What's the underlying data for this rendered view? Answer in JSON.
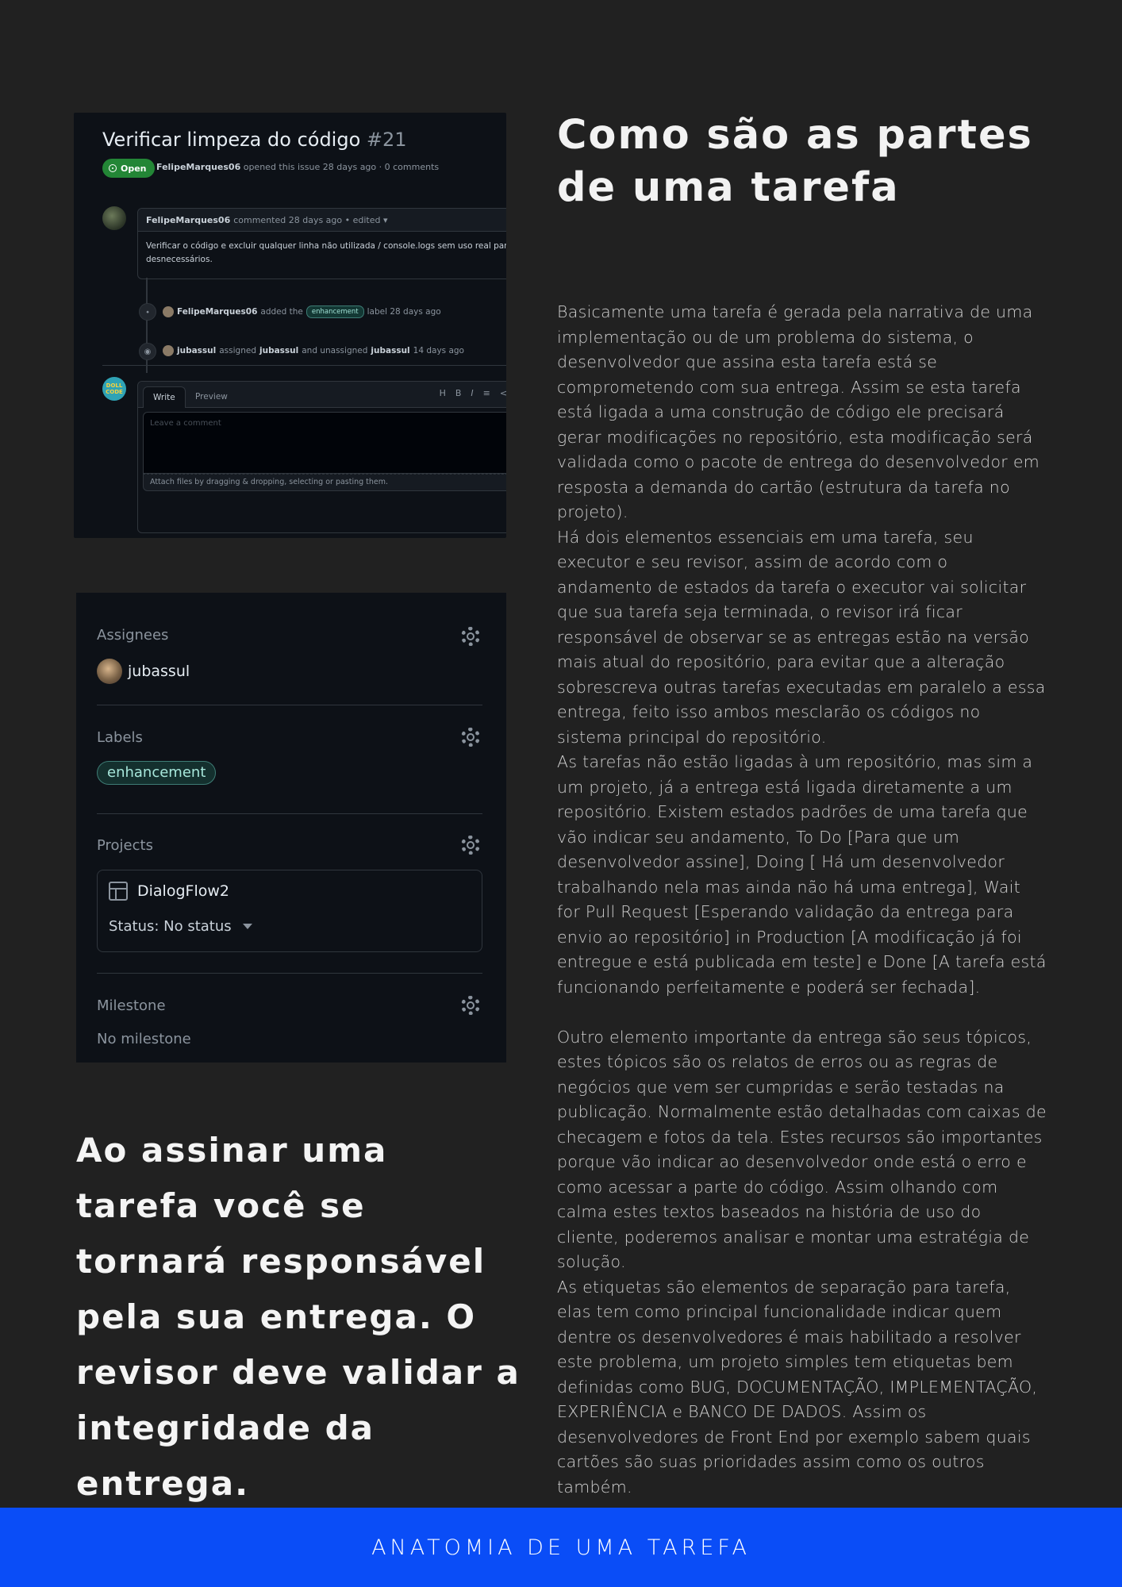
{
  "heading": "Como são as partes de uma tarefa",
  "paragraphs": [
    "Basicamente uma tarefa é gerada pela narrativa de uma implementação ou de um problema do sistema, o desenvolvedor que assina esta tarefa está se comprometendo com sua entrega. Assim se esta tarefa está ligada a uma construção de código ele precisará gerar modificações no repositório, esta modificação será validada como o pacote de entrega do desenvolvedor em resposta a demanda do cartão (estrutura da tarefa no projeto).",
    "Há dois elementos essenciais em uma tarefa, seu executor e seu revisor, assim de acordo com o andamento de estados da tarefa o executor vai solicitar que sua tarefa seja terminada, o revisor irá ficar responsável de observar se as entregas estão na versão mais atual do repositório, para evitar que a alteração sobrescreva outras tarefas executadas em paralelo a essa entrega, feito isso ambos mesclarão os códigos no sistema principal do repositório.",
    "As tarefas não estão ligadas à um repositório, mas sim a um projeto, já a entrega está ligada diretamente a um repositório. Existem estados padrões de uma tarefa que vão indicar seu andamento, To Do [Para que um desenvolvedor assine], Doing [ Há um desenvolvedor trabalhando nela mas ainda não há uma entrega], Wait for Pull Request [Esperando validação da entrega para envio ao repositório] in Production [A modificação já foi entregue e está publicada em teste] e Done [A tarefa está funcionando perfeitamente e poderá ser fechada].",
    "Outro elemento importante da entrega são seus tópicos, estes tópicos são os relatos de erros ou as regras de negócios que vem ser cumpridas e serão testadas na publicação. Normalmente estão detalhadas com caixas de checagem e fotos da tela. Estes recursos são importantes porque vão indicar ao desenvolvedor onde está o erro e como acessar a parte do código. Assim olhando com calma estes textos baseados na história de uso do cliente, poderemos analisar e montar uma estratégia de solução.",
    "As etiquetas são elementos de separação para tarefa, elas tem como principal funcionalidade indicar quem dentre os desenvolvedores é mais habilitado a resolver este problema, um projeto simples tem etiquetas bem definidas como BUG, DOCUMENTAÇÃO, IMPLEMENTAÇÃO, EXPERIÊNCIA e BANCO DE DADOS. Assim os desenvolvedores de Front End por exemplo sabem quais cartões são suas prioridades assim como os outros também."
  ],
  "quote": "Ao assinar uma tarefa você se tornará responsável pela sua entrega. O revisor deve validar a integridade da entrega.",
  "banner": "ANATOMIA DE UMA TAREFA",
  "issue": {
    "title": "Verificar limpeza do código",
    "number": "#21",
    "state": "Open",
    "meta_author": "FelipeMarques06",
    "meta_text": "opened this issue 28 days ago · 0 comments",
    "comment_author": "FelipeMarques06",
    "comment_meta": "commented 28 days ago • edited ▾",
    "comment_line1": "Verificar o código e excluir qualquer linha não utilizada / console.logs sem uso real para a aplicação",
    "comment_line2": "desnecessários.",
    "event1": {
      "author": "FelipeMarques06",
      "pre": "added the",
      "label": "enhancement",
      "post": "label 28 days ago"
    },
    "event2": {
      "author": "jubassul",
      "pre": "assigned",
      "target": "jubassul",
      "mid": "and unassigned",
      "target2": "jubassul",
      "post": "14 days ago"
    },
    "avatar_text": "DOLL CODE",
    "tab_write": "Write",
    "tab_preview": "Preview",
    "toolbar": [
      "H",
      "B",
      "I",
      "≡",
      "<>",
      "🔗"
    ],
    "comment_placeholder": "Leave a comment",
    "attach_text": "Attach files by dragging & dropping, selecting or pasting them."
  },
  "sidebar": {
    "assignees_label": "Assignees",
    "assignee": "jubassul",
    "labels_label": "Labels",
    "label": "enhancement",
    "projects_label": "Projects",
    "project_name": "DialogFlow2",
    "project_status": "Status: No status",
    "milestone_label": "Milestone",
    "milestone_value": "No milestone"
  },
  "colors": {
    "background": "#212121",
    "banner": "#0a4df7",
    "open_badge": "#238636",
    "label_border": "#3e7c75"
  }
}
